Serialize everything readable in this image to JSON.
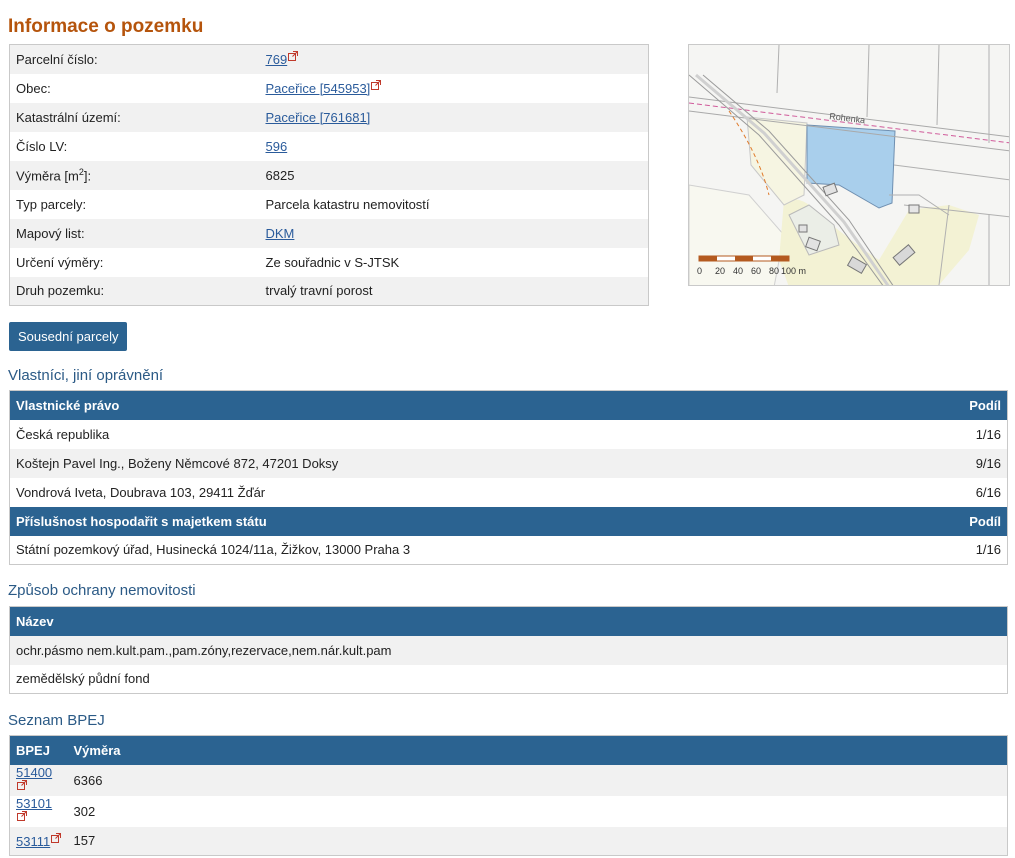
{
  "title": "Informace o pozemku",
  "info": {
    "rows": [
      {
        "label": "Parcelní číslo:",
        "value": "769",
        "link": true,
        "ext": true
      },
      {
        "label": "Obec:",
        "value": "Paceřice [545953]",
        "link": true,
        "ext": true
      },
      {
        "label": "Katastrální území:",
        "value": "Paceřice [761681]",
        "link": true,
        "ext": false
      },
      {
        "label": "Číslo LV:",
        "value": "596",
        "link": true,
        "ext": false
      },
      {
        "label": "Výměra [m",
        "label_sup": "2",
        "label_tail": "]:",
        "value": "6825",
        "link": false,
        "ext": false
      },
      {
        "label": "Typ parcely:",
        "value": "Parcela katastru nemovitostí",
        "link": false,
        "ext": false
      },
      {
        "label": "Mapový list:",
        "value": "DKM",
        "link": true,
        "ext": false
      },
      {
        "label": "Určení výměry:",
        "value": "Ze souřadnic v S-JTSK",
        "link": false,
        "ext": false
      },
      {
        "label": "Druh pozemku:",
        "value": "trvalý travní porost",
        "link": false,
        "ext": false
      }
    ]
  },
  "map": {
    "road_label": "Rohenka",
    "scale_ticks": [
      "0",
      "20",
      "40",
      "60",
      "80"
    ],
    "scale_unit": "100 m"
  },
  "neighbors_button": "Sousední parcely",
  "owners": {
    "heading": "Vlastníci, jiní oprávnění",
    "groups": [
      {
        "header": "Vlastnické právo",
        "share_header": "Podíl",
        "rows": [
          {
            "name": "Česká republika",
            "share": "1/16"
          },
          {
            "name": "Koštejn Pavel Ing., Boženy Němcové 872, 47201 Doksy",
            "share": "9/16"
          },
          {
            "name": "Vondrová Iveta, Doubrava 103, 29411 Žďár",
            "share": "6/16"
          }
        ]
      },
      {
        "header": "Příslušnost hospodařit s majetkem státu",
        "share_header": "Podíl",
        "rows": [
          {
            "name": "Státní pozemkový úřad, Husinecká 1024/11a, Žižkov, 13000 Praha 3",
            "share": "1/16"
          }
        ]
      }
    ]
  },
  "protection": {
    "heading": "Způsob ochrany nemovitosti",
    "header": "Název",
    "rows": [
      "ochr.pásmo nem.kult.pam.,pam.zóny,rezervace,nem.nár.kult.pam",
      "zemědělský půdní fond"
    ]
  },
  "bpej": {
    "heading": "Seznam BPEJ",
    "col_code": "BPEJ",
    "col_area": "Výměra",
    "rows": [
      {
        "code": "51400",
        "area": "6366"
      },
      {
        "code": "53101",
        "area": "302"
      },
      {
        "code": "53111",
        "area": "157"
      }
    ]
  },
  "colors": {
    "title": "#b5540c",
    "section_heading": "#2b5a86",
    "header_bg": "#2b6391",
    "link": "#2a5b9b",
    "parcel_fill": "#a9cfec"
  }
}
